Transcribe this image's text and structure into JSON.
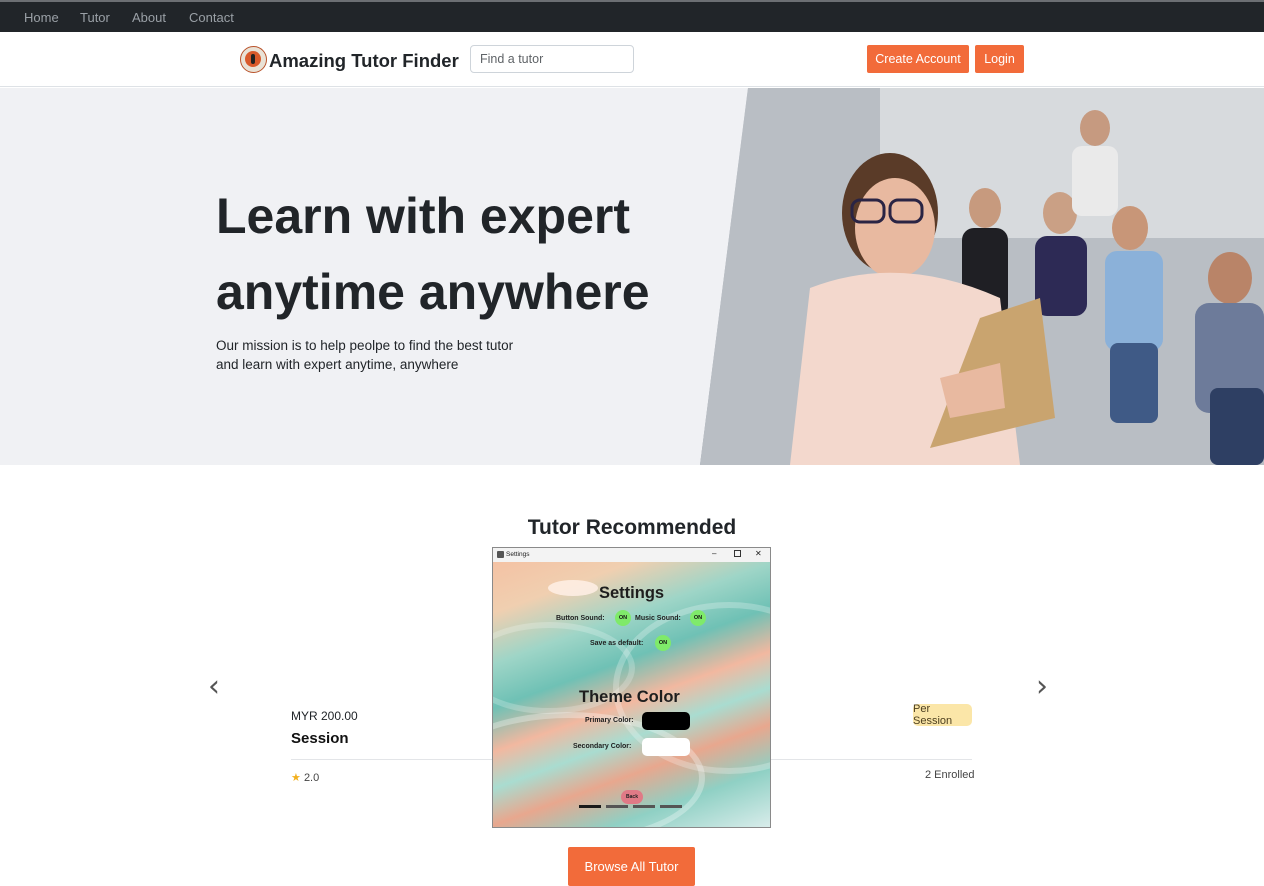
{
  "topnav": {
    "items": [
      "Home",
      "Tutor",
      "About",
      "Contact"
    ]
  },
  "header": {
    "brand": "Amazing Tutor Finder",
    "search_placeholder": "Find a tutor",
    "create_account": "Create Account",
    "login": "Login"
  },
  "hero": {
    "title_line1": "Learn with expert",
    "title_line2": "anytime anywhere",
    "sub_line1": "Our mission is to help peolpe to find the best tutor",
    "sub_line2": "and learn with expert anytime, anywhere"
  },
  "section": {
    "title": "Tutor Recommended",
    "card": {
      "price": "MYR 200.00",
      "title": "Session",
      "badge": "Per Session",
      "rating": "2.0",
      "enrolled": "2 Enrolled"
    },
    "browse": "Browse All Tutor"
  },
  "settings_window": {
    "title": "Settings",
    "heading": "Settings",
    "button_sound_label": "Button Sound:",
    "button_sound_value": "ON",
    "music_sound_label": "Music Sound:",
    "music_sound_value": "ON",
    "save_default_label": "Save as default:",
    "save_default_value": "ON",
    "theme_heading": "Theme Color",
    "primary_label": "Primary Color:",
    "secondary_label": "Secondary Color:",
    "primary_color": "#000000",
    "secondary_color": "#ffffff",
    "back": "Back"
  },
  "colors": {
    "accent": "#f26b3a",
    "dark_nav": "#212529",
    "hero_bg": "#f0f1f4",
    "badge_bg": "#fbe6a8"
  },
  "icons": [
    "logo-icon",
    "star-icon",
    "chevron-left-icon",
    "chevron-right-icon",
    "minimize-icon",
    "maximize-icon",
    "close-icon"
  ]
}
